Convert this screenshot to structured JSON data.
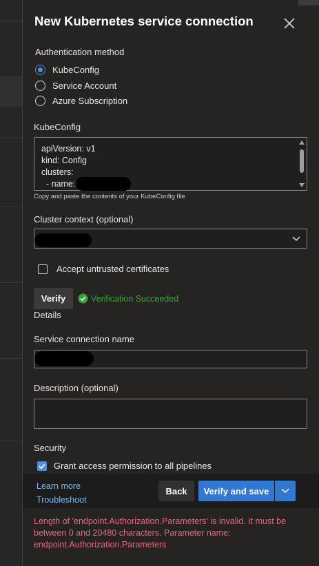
{
  "title": "New Kubernetes service connection",
  "auth": {
    "label": "Authentication method",
    "options": [
      "KubeConfig",
      "Service Account",
      "Azure Subscription"
    ],
    "selected": "KubeConfig"
  },
  "kubeconfig": {
    "label": "KubeConfig",
    "lines": [
      "apiVersion: v1",
      "kind: Config",
      "clusters:",
      "  - name:"
    ],
    "hint": "Copy and paste the contents of your KubeConfig file"
  },
  "cluster_context": {
    "label": "Cluster context (optional)"
  },
  "untrusted": {
    "label": "Accept untrusted certificates",
    "checked": false
  },
  "verify": {
    "button_label": "Verify",
    "status_text": "Verification Succeeded"
  },
  "details": {
    "label": "Details"
  },
  "service_connection_name": {
    "label": "Service connection name"
  },
  "description": {
    "label": "Description (optional)"
  },
  "security": {
    "label": "Security",
    "grant_label": "Grant access permission to all pipelines",
    "checked": true
  },
  "footer": {
    "learn_more": "Learn more",
    "troubleshoot": "Troubleshoot",
    "back_label": "Back",
    "primary_label": "Verify and save"
  },
  "error_text": "Length of 'endpoint.Authorization.Parameters' is invalid. It must be between 0 and 20480 characters. Parameter name: endpoint.Authorization.Parameters",
  "colors": {
    "accent": "#3277d0",
    "success": "#37a53a",
    "error": "#e26a7a"
  }
}
